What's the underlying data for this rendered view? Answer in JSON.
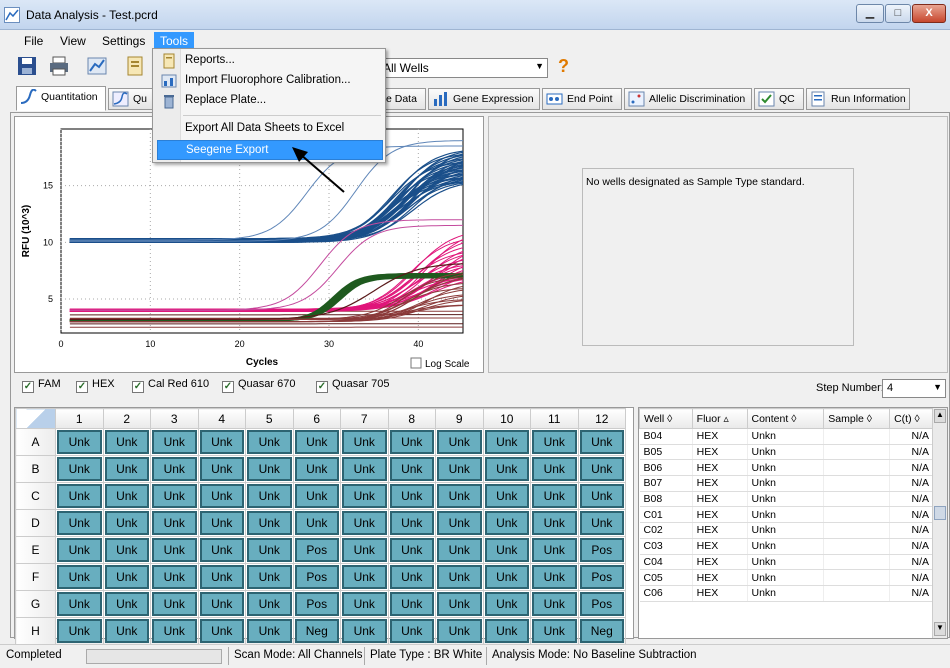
{
  "window": {
    "title": "Data Analysis - Test.pcrd",
    "minimize": "▁",
    "maximize": "□",
    "close": "X"
  },
  "menu": {
    "items": [
      "File",
      "View",
      "Settings",
      "Tools"
    ]
  },
  "tools_menu": {
    "items": [
      "Reports...",
      "Import Fluorophore Calibration...",
      "Replace Plate...",
      "Export All Data Sheets to Excel",
      "Seegene Export"
    ]
  },
  "toolbar": {
    "well_select": "All Wells",
    "help": "?"
  },
  "tabs": [
    "Quantitation",
    "Qu",
    "e Data",
    "Gene Expression",
    "End Point",
    "Allelic Discrimination",
    "QC",
    "Run Information"
  ],
  "std_message": "No wells designated as Sample Type standard.",
  "fluors": [
    "FAM",
    "HEX",
    "Cal Red 610",
    "Quasar 670",
    "Quasar 705"
  ],
  "step": {
    "label": "Step Number:",
    "value": "4"
  },
  "chart_data": {
    "type": "line",
    "xlabel": "Cycles",
    "ylabel": "RFU (10^3)",
    "xlim": [
      0,
      45
    ],
    "ylim": [
      2,
      20
    ],
    "xticks": [
      0,
      10,
      20,
      30,
      40
    ],
    "yticks": [
      5,
      10,
      15
    ],
    "log_scale_label": "Log Scale",
    "series_colors": [
      "#1a4f8a",
      "#e0157a",
      "#c44b9e",
      "#1f5a1f",
      "#8b3a3a",
      "#5a1a1a"
    ]
  },
  "plate": {
    "columns": [
      "1",
      "2",
      "3",
      "4",
      "5",
      "6",
      "7",
      "8",
      "9",
      "10",
      "11",
      "12"
    ],
    "rows": [
      {
        "label": "A",
        "cells": [
          "Unk",
          "Unk",
          "Unk",
          "Unk",
          "Unk",
          "Unk",
          "Unk",
          "Unk",
          "Unk",
          "Unk",
          "Unk",
          "Unk"
        ]
      },
      {
        "label": "B",
        "cells": [
          "Unk",
          "Unk",
          "Unk",
          "Unk",
          "Unk",
          "Unk",
          "Unk",
          "Unk",
          "Unk",
          "Unk",
          "Unk",
          "Unk"
        ]
      },
      {
        "label": "C",
        "cells": [
          "Unk",
          "Unk",
          "Unk",
          "Unk",
          "Unk",
          "Unk",
          "Unk",
          "Unk",
          "Unk",
          "Unk",
          "Unk",
          "Unk"
        ]
      },
      {
        "label": "D",
        "cells": [
          "Unk",
          "Unk",
          "Unk",
          "Unk",
          "Unk",
          "Unk",
          "Unk",
          "Unk",
          "Unk",
          "Unk",
          "Unk",
          "Unk"
        ]
      },
      {
        "label": "E",
        "cells": [
          "Unk",
          "Unk",
          "Unk",
          "Unk",
          "Unk",
          "Pos",
          "Unk",
          "Unk",
          "Unk",
          "Unk",
          "Unk",
          "Pos"
        ]
      },
      {
        "label": "F",
        "cells": [
          "Unk",
          "Unk",
          "Unk",
          "Unk",
          "Unk",
          "Pos",
          "Unk",
          "Unk",
          "Unk",
          "Unk",
          "Unk",
          "Pos"
        ]
      },
      {
        "label": "G",
        "cells": [
          "Unk",
          "Unk",
          "Unk",
          "Unk",
          "Unk",
          "Pos",
          "Unk",
          "Unk",
          "Unk",
          "Unk",
          "Unk",
          "Pos"
        ]
      },
      {
        "label": "H",
        "cells": [
          "Unk",
          "Unk",
          "Unk",
          "Unk",
          "Unk",
          "Neg",
          "Unk",
          "Unk",
          "Unk",
          "Unk",
          "Unk",
          "Neg"
        ]
      }
    ]
  },
  "well_table": {
    "headers": [
      "Well ◊",
      "Fluor ▵",
      "Content ◊",
      "Sample ◊",
      "C(t) ◊"
    ],
    "rows": [
      [
        "B04",
        "HEX",
        "Unkn",
        "",
        "N/A"
      ],
      [
        "B05",
        "HEX",
        "Unkn",
        "",
        "N/A"
      ],
      [
        "B06",
        "HEX",
        "Unkn",
        "",
        "N/A"
      ],
      [
        "B07",
        "HEX",
        "Unkn",
        "",
        "N/A"
      ],
      [
        "B08",
        "HEX",
        "Unkn",
        "",
        "N/A"
      ],
      [
        "C01",
        "HEX",
        "Unkn",
        "",
        "N/A"
      ],
      [
        "C02",
        "HEX",
        "Unkn",
        "",
        "N/A"
      ],
      [
        "C03",
        "HEX",
        "Unkn",
        "",
        "N/A"
      ],
      [
        "C04",
        "HEX",
        "Unkn",
        "",
        "N/A"
      ],
      [
        "C05",
        "HEX",
        "Unkn",
        "",
        "N/A"
      ],
      [
        "C06",
        "HEX",
        "Unkn",
        "",
        "N/A"
      ]
    ]
  },
  "status": {
    "state": "Completed",
    "scan_mode": "Scan Mode: All Channels",
    "plate_type": "Plate Type : BR White",
    "analysis_mode": "Analysis Mode: No Baseline Subtraction"
  }
}
